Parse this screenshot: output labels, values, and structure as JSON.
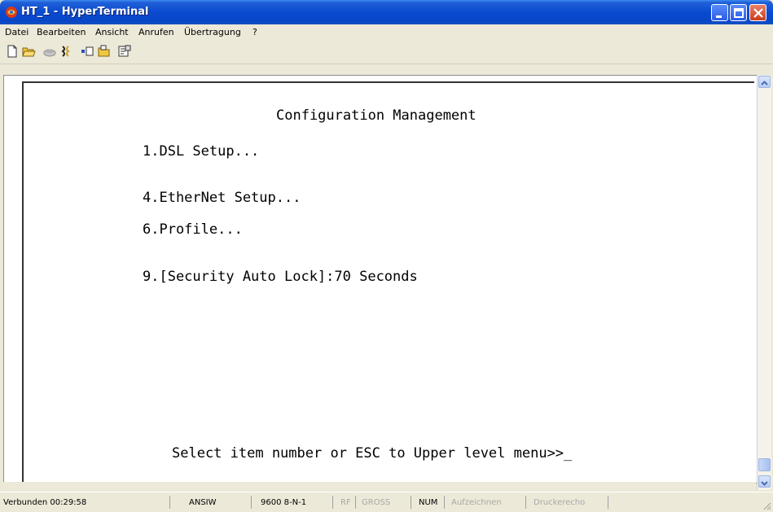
{
  "window": {
    "title": "HT_1 - HyperTerminal"
  },
  "menu": {
    "items": [
      "Datei",
      "Bearbeiten",
      "Ansicht",
      "Anrufen",
      "Übertragung",
      "?"
    ]
  },
  "toolbar": {
    "icons": [
      "new-icon",
      "open-icon",
      "disconnect-icon",
      "connect-icon",
      "send-icon",
      "receive-icon",
      "properties-icon"
    ]
  },
  "terminal": {
    "title": "Configuration Management",
    "items": [
      "1.DSL Setup...",
      "4.EtherNet Setup...",
      "6.Profile...",
      "9.[Security Auto Lock]:70 Seconds"
    ],
    "prompt": "Select item number or ESC to Upper level menu>>_"
  },
  "status": {
    "connected": "Verbunden 00:29:58",
    "emulation": "ANSIW",
    "settings": "9600 8-N-1",
    "rf": "RF",
    "gross": "GROSS",
    "num": "NUM",
    "capture": "Aufzeichnen",
    "print_echo": "Druckerecho"
  },
  "colors": {
    "titlebar": "#0a4ad0",
    "chrome": "#ece9d8",
    "terminal_bg": "#ffffff",
    "terminal_text": "#000000"
  }
}
